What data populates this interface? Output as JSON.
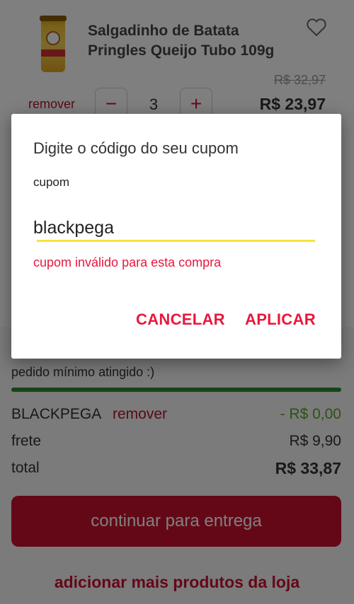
{
  "product": {
    "title": "Salgadinho de Batata Pringles Queijo Tubo 109g",
    "old_price": "R$ 32,97",
    "current_price": "R$ 23,97",
    "remove_label": "remover",
    "quantity": "3",
    "minus_symbol": "−",
    "plus_symbol": "+",
    "favorite_icon": "heart-outline-icon"
  },
  "dialog": {
    "title": "Digite o código do seu cupom",
    "field_label": "cupom",
    "input_value": "blackpega",
    "error": "cupom inválido para esta compra",
    "cancel_label": "CANCELAR",
    "apply_label": "APLICAR"
  },
  "summary": {
    "min_order_text": "pedido mínimo atingido :)",
    "min_order_progress_percent": 100,
    "coupon_code": "BLACKPEGA",
    "coupon_remove_label": "remover",
    "coupon_discount": "- R$ 0,00",
    "shipping_label": "frete",
    "shipping_value": "R$ 9,90",
    "total_label": "total",
    "total_value": "R$ 33,87",
    "continue_label": "continuar para entrega",
    "add_more_label": "adicionar mais produtos da loja"
  },
  "colors": {
    "accent": "#e8173c",
    "button_red": "#c8102e",
    "discount_green": "#58a32b",
    "progress_green": "#2e8b2e",
    "input_underline": "#f7e439"
  }
}
